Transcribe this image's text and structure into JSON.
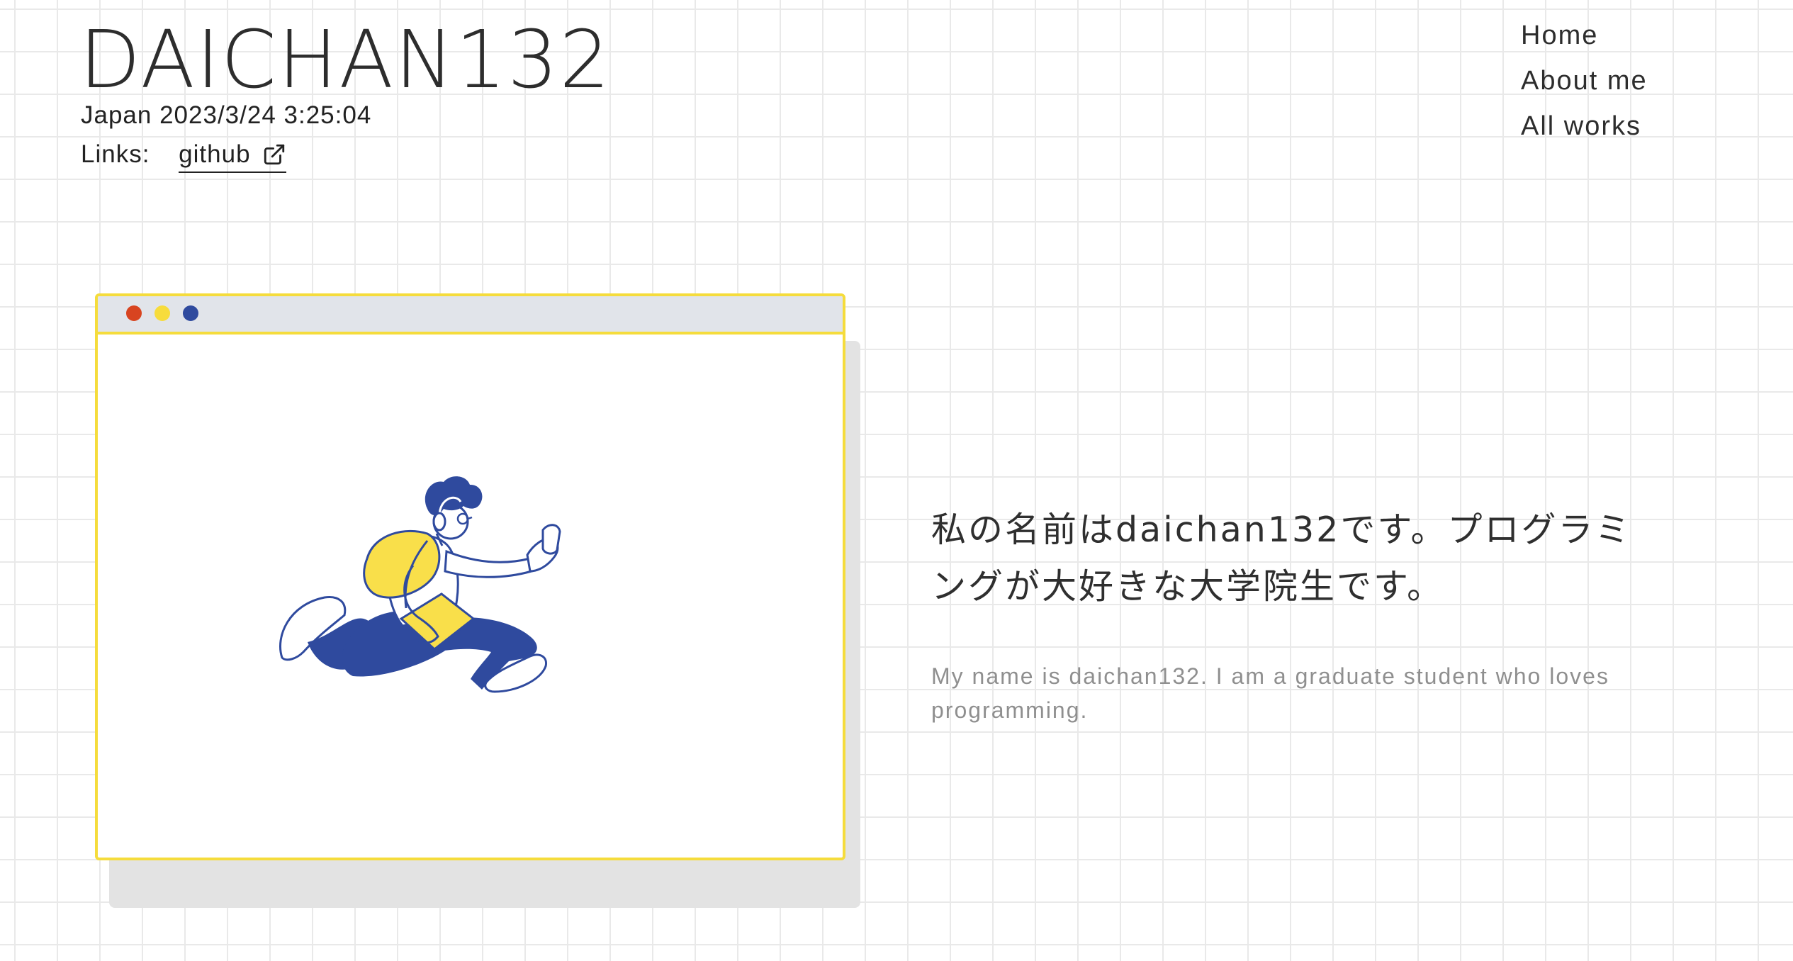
{
  "header": {
    "site_title": "DAICHAN132",
    "datetime": "Japan 2023/3/24 3:25:04",
    "links_label": "Links:",
    "github_label": "github"
  },
  "nav": {
    "items": [
      {
        "label": "Home"
      },
      {
        "label": "About me"
      },
      {
        "label": "All works"
      }
    ]
  },
  "hero": {
    "intro_ja": "私の名前はdaichan132です。プログラミングが大好きな大学院生です。",
    "intro_en": "My name is daichan132. I am a graduate student who loves programming."
  },
  "colors": {
    "grid_line": "#e9e9e9",
    "window_border": "#f5dc3c",
    "titlebar": "#e1e4ea",
    "dot_red": "#d84420",
    "dot_yellow": "#f7dc3c",
    "dot_blue": "#2f4a9e",
    "illustration_blue": "#2f4a9e",
    "illustration_yellow": "#f9df4a"
  },
  "icons": [
    "external-link-icon",
    "running-student-illustration"
  ]
}
